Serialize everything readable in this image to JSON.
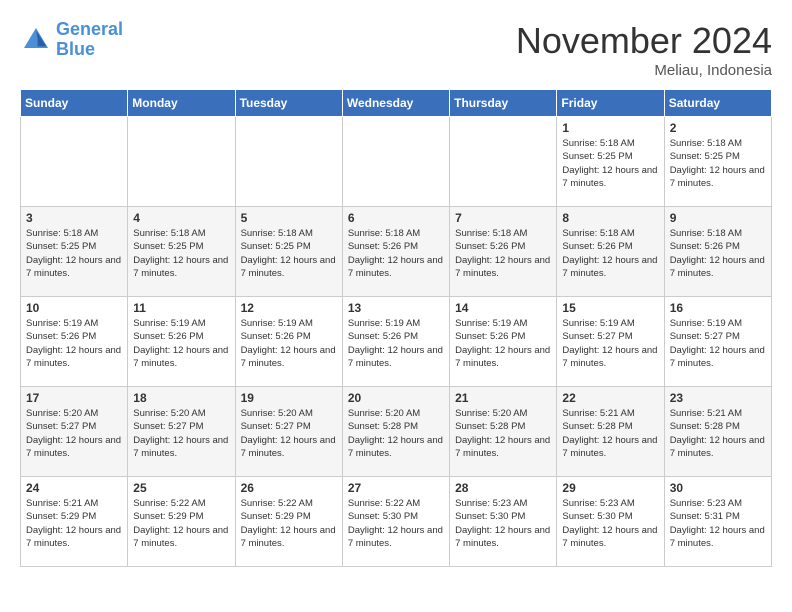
{
  "logo": {
    "line1": "General",
    "line2": "Blue"
  },
  "header": {
    "month": "November 2024",
    "location": "Meliau, Indonesia"
  },
  "days_of_week": [
    "Sunday",
    "Monday",
    "Tuesday",
    "Wednesday",
    "Thursday",
    "Friday",
    "Saturday"
  ],
  "weeks": [
    [
      {
        "day": "",
        "info": ""
      },
      {
        "day": "",
        "info": ""
      },
      {
        "day": "",
        "info": ""
      },
      {
        "day": "",
        "info": ""
      },
      {
        "day": "",
        "info": ""
      },
      {
        "day": "1",
        "info": "Sunrise: 5:18 AM\nSunset: 5:25 PM\nDaylight: 12 hours and 7 minutes."
      },
      {
        "day": "2",
        "info": "Sunrise: 5:18 AM\nSunset: 5:25 PM\nDaylight: 12 hours and 7 minutes."
      }
    ],
    [
      {
        "day": "3",
        "info": "Sunrise: 5:18 AM\nSunset: 5:25 PM\nDaylight: 12 hours and 7 minutes."
      },
      {
        "day": "4",
        "info": "Sunrise: 5:18 AM\nSunset: 5:25 PM\nDaylight: 12 hours and 7 minutes."
      },
      {
        "day": "5",
        "info": "Sunrise: 5:18 AM\nSunset: 5:25 PM\nDaylight: 12 hours and 7 minutes."
      },
      {
        "day": "6",
        "info": "Sunrise: 5:18 AM\nSunset: 5:26 PM\nDaylight: 12 hours and 7 minutes."
      },
      {
        "day": "7",
        "info": "Sunrise: 5:18 AM\nSunset: 5:26 PM\nDaylight: 12 hours and 7 minutes."
      },
      {
        "day": "8",
        "info": "Sunrise: 5:18 AM\nSunset: 5:26 PM\nDaylight: 12 hours and 7 minutes."
      },
      {
        "day": "9",
        "info": "Sunrise: 5:18 AM\nSunset: 5:26 PM\nDaylight: 12 hours and 7 minutes."
      }
    ],
    [
      {
        "day": "10",
        "info": "Sunrise: 5:19 AM\nSunset: 5:26 PM\nDaylight: 12 hours and 7 minutes."
      },
      {
        "day": "11",
        "info": "Sunrise: 5:19 AM\nSunset: 5:26 PM\nDaylight: 12 hours and 7 minutes."
      },
      {
        "day": "12",
        "info": "Sunrise: 5:19 AM\nSunset: 5:26 PM\nDaylight: 12 hours and 7 minutes."
      },
      {
        "day": "13",
        "info": "Sunrise: 5:19 AM\nSunset: 5:26 PM\nDaylight: 12 hours and 7 minutes."
      },
      {
        "day": "14",
        "info": "Sunrise: 5:19 AM\nSunset: 5:26 PM\nDaylight: 12 hours and 7 minutes."
      },
      {
        "day": "15",
        "info": "Sunrise: 5:19 AM\nSunset: 5:27 PM\nDaylight: 12 hours and 7 minutes."
      },
      {
        "day": "16",
        "info": "Sunrise: 5:19 AM\nSunset: 5:27 PM\nDaylight: 12 hours and 7 minutes."
      }
    ],
    [
      {
        "day": "17",
        "info": "Sunrise: 5:20 AM\nSunset: 5:27 PM\nDaylight: 12 hours and 7 minutes."
      },
      {
        "day": "18",
        "info": "Sunrise: 5:20 AM\nSunset: 5:27 PM\nDaylight: 12 hours and 7 minutes."
      },
      {
        "day": "19",
        "info": "Sunrise: 5:20 AM\nSunset: 5:27 PM\nDaylight: 12 hours and 7 minutes."
      },
      {
        "day": "20",
        "info": "Sunrise: 5:20 AM\nSunset: 5:28 PM\nDaylight: 12 hours and 7 minutes."
      },
      {
        "day": "21",
        "info": "Sunrise: 5:20 AM\nSunset: 5:28 PM\nDaylight: 12 hours and 7 minutes."
      },
      {
        "day": "22",
        "info": "Sunrise: 5:21 AM\nSunset: 5:28 PM\nDaylight: 12 hours and 7 minutes."
      },
      {
        "day": "23",
        "info": "Sunrise: 5:21 AM\nSunset: 5:28 PM\nDaylight: 12 hours and 7 minutes."
      }
    ],
    [
      {
        "day": "24",
        "info": "Sunrise: 5:21 AM\nSunset: 5:29 PM\nDaylight: 12 hours and 7 minutes."
      },
      {
        "day": "25",
        "info": "Sunrise: 5:22 AM\nSunset: 5:29 PM\nDaylight: 12 hours and 7 minutes."
      },
      {
        "day": "26",
        "info": "Sunrise: 5:22 AM\nSunset: 5:29 PM\nDaylight: 12 hours and 7 minutes."
      },
      {
        "day": "27",
        "info": "Sunrise: 5:22 AM\nSunset: 5:30 PM\nDaylight: 12 hours and 7 minutes."
      },
      {
        "day": "28",
        "info": "Sunrise: 5:23 AM\nSunset: 5:30 PM\nDaylight: 12 hours and 7 minutes."
      },
      {
        "day": "29",
        "info": "Sunrise: 5:23 AM\nSunset: 5:30 PM\nDaylight: 12 hours and 7 minutes."
      },
      {
        "day": "30",
        "info": "Sunrise: 5:23 AM\nSunset: 5:31 PM\nDaylight: 12 hours and 7 minutes."
      }
    ]
  ]
}
